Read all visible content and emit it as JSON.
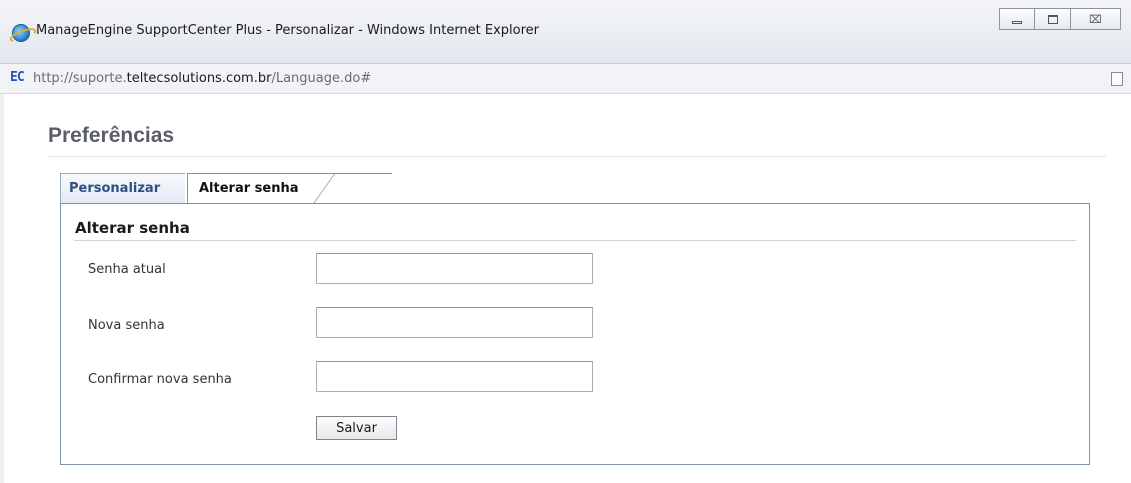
{
  "window": {
    "title": "ManageEngine SupportCenter Plus - Personalizar - Windows Internet Explorer",
    "icon": "internet-explorer-icon",
    "controls": {
      "minimize": "minimize-icon",
      "maximize": "maximize-icon",
      "close_symbol": "⌧"
    }
  },
  "address": {
    "site_badge": "EC",
    "url_prefix": "http://suporte.",
    "url_domain": "teltecsolutions.com.br",
    "url_suffix": "/Language.do#"
  },
  "page": {
    "title": "Preferências",
    "tabs": [
      {
        "label": "Personalizar",
        "active": false
      },
      {
        "label": "Alterar senha",
        "active": true
      }
    ],
    "section_title": "Alterar senha",
    "fields": [
      {
        "label": "Senha atual",
        "value": ""
      },
      {
        "label": "Nova senha",
        "value": ""
      },
      {
        "label": "Confirmar nova senha",
        "value": ""
      }
    ],
    "save_label": "Salvar"
  },
  "colors": {
    "tab_inactive_text": "#2f4f85",
    "panel_border": "#8090a8",
    "page_title": "#5a5f66"
  }
}
